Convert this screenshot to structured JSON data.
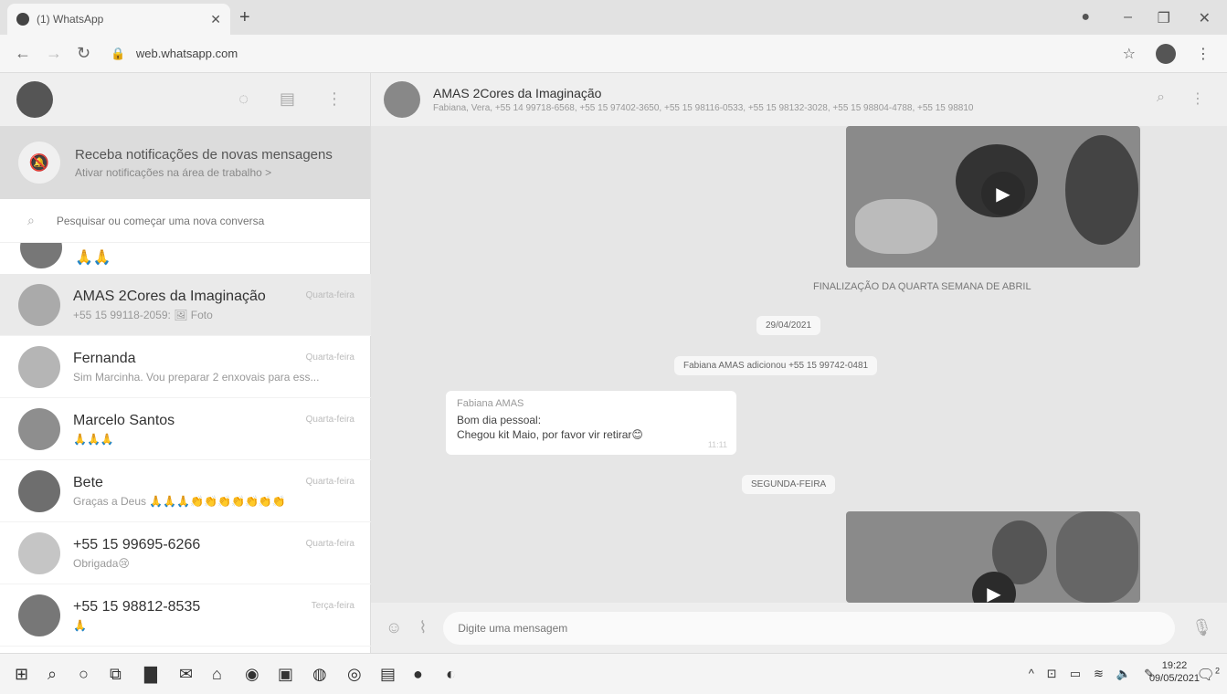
{
  "browser": {
    "tab_title": "(1) WhatsApp",
    "new_tab": "+",
    "url": "web.whatsapp.com"
  },
  "left_panel": {
    "notification": {
      "title": "Receba notificações de novas mensagens",
      "subtitle": "Ativar notificações na área de trabalho >"
    },
    "search_placeholder": "Pesquisar ou começar uma nova conversa",
    "chats": [
      {
        "name": "AMAS 2Cores da Imaginação",
        "preview": "+55 15 99118-2059: 🖼 Foto",
        "time": "Quarta-feira",
        "active": true
      },
      {
        "name": "Fernanda",
        "preview": "Sim Marcinha. Vou preparar 2 enxovais para ess...",
        "time": "Quarta-feira"
      },
      {
        "name": "Marcelo Santos",
        "preview": "🙏🙏🙏",
        "time": "Quarta-feira"
      },
      {
        "name": "Bete",
        "preview": "Graças a Deus 🙏🙏🙏👏👏👏👏👏👏👏",
        "time": "Quarta-feira"
      },
      {
        "name": "+55 15 99695-6266",
        "preview": "Obrigada😢",
        "time": "Quarta-feira"
      },
      {
        "name": "+55 15 98812-8535",
        "preview": "🙏",
        "time": "Terça-feira"
      }
    ]
  },
  "chat": {
    "title": "AMAS 2Cores da Imaginação",
    "participants": "Fabiana, Vera, +55 14 99718-6568, +55 15 97402-3650, +55 15 98116-0533, +55 15 98132-3028, +55 15 98804-4788, +55 15 98810",
    "messages": {
      "caption": "FINALIZAÇÃO DA QUARTA SEMANA DE ABRIL",
      "date1": "29/04/2021",
      "system": "Fabiana AMAS adicionou +55 15 99742-0481",
      "bubble": {
        "sender": "Fabiana AMAS",
        "line1": "Bom dia pessoal:",
        "line2": "Chegou kit Maio, por favor vir retirar😊",
        "time": "11:11"
      },
      "date2": "SEGUNDA-FEIRA"
    },
    "composer_placeholder": "Digite uma mensagem"
  },
  "taskbar": {
    "time": "19:22",
    "date": "09/05/2021",
    "notif_count": "2"
  }
}
